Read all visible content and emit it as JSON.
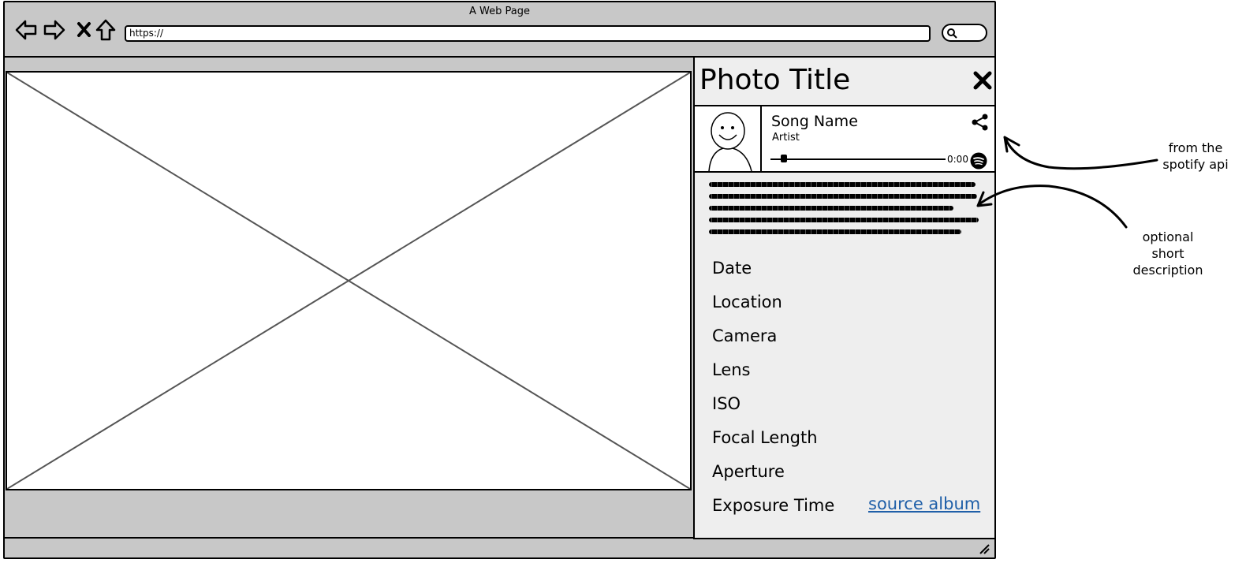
{
  "window": {
    "title": "A Web Page"
  },
  "address_bar": {
    "url": "https://"
  },
  "panel": {
    "title": "Photo Title",
    "player": {
      "song": "Song Name",
      "artist": "Artist",
      "time": "0:00",
      "progress": 0.06
    },
    "metadata_labels": [
      "Date",
      "Location",
      "Camera",
      "Lens",
      "ISO",
      "Focal Length",
      "Aperture",
      "Exposure Time"
    ],
    "source_link": "source album"
  },
  "annotations": {
    "spotify_note_line1": "from the",
    "spotify_note_line2": "spotify api",
    "description_note_line1": "optional",
    "description_note_line2": "short",
    "description_note_line3": "description"
  },
  "icons": [
    "back-icon",
    "forward-icon",
    "stop-icon",
    "home-icon",
    "search-icon",
    "close-icon",
    "share-icon",
    "spotify-icon",
    "resize-grip-icon"
  ]
}
